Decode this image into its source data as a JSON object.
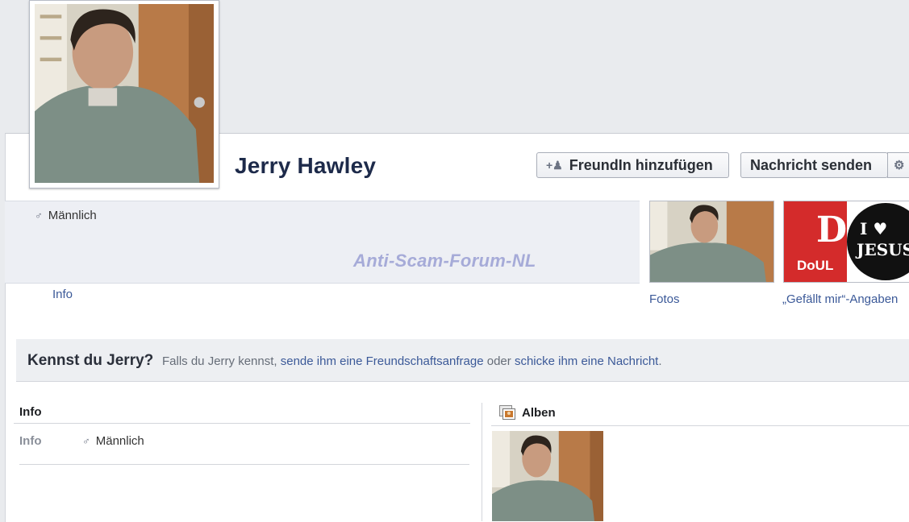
{
  "profile": {
    "name": "Jerry Hawley",
    "gender": "Männlich"
  },
  "actions": {
    "add_friend": "FreundIn hinzufügen",
    "send_message": "Nachricht senden"
  },
  "watermark": "Anti-Scam-Forum-NL",
  "tabs": {
    "info": "Info",
    "photos": "Fotos",
    "likes": "„Gefällt mir“-Angaben"
  },
  "like_badge": {
    "letter": "D",
    "text": "DoUL",
    "heart_line": "I ♥",
    "jesus": "JESUS"
  },
  "know_bar": {
    "title": "Kennst du Jerry?",
    "prefix": "Falls du Jerry kennst,",
    "friend_request_link": "sende ihm eine Freundschaftsanfrage",
    "or": "oder",
    "message_link": "schicke ihm eine Nachricht",
    "suffix": "."
  },
  "info_section": {
    "heading": "Info",
    "row_key": "Info",
    "row_value": "Männlich"
  },
  "albums_section": {
    "heading": "Alben"
  },
  "colors": {
    "link": "#3b5998",
    "name": "#1d2a4a",
    "page_bg": "#e9ebee"
  },
  "icons": [
    "add-friend-icon",
    "gear-icon",
    "male-icon",
    "album-icon"
  ]
}
